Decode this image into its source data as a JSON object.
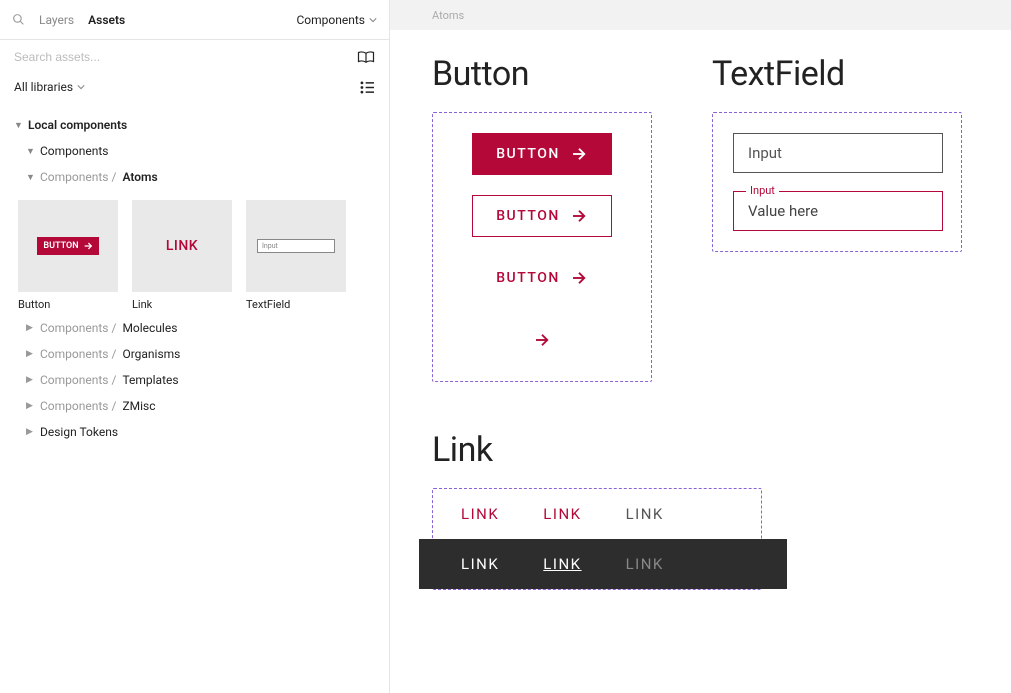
{
  "top": {
    "tab_layers": "Layers",
    "tab_assets": "Assets",
    "pages_dropdown": "Components"
  },
  "search": {
    "placeholder": "Search assets..."
  },
  "lib_filter": "All libraries",
  "tree": {
    "local_components": "Local components",
    "components": "Components",
    "prefix": "Components / ",
    "atoms": "Atoms",
    "molecules": "Molecules",
    "organisms": "Organisms",
    "templates": "Templates",
    "zmisc": "ZMisc",
    "design_tokens": "Design Tokens"
  },
  "thumbs": {
    "button": "Button",
    "link": "Link",
    "textfield": "TextField",
    "mini_btn": "BUTTON",
    "mini_link": "LINK",
    "mini_input": "Input"
  },
  "canvas": {
    "breadcrumb": "Atoms",
    "section_button": "Button",
    "section_textfield": "TextField",
    "section_link": "Link",
    "btn_label": "BUTTON",
    "tf_placeholder": "Input",
    "tf_float_label": "Input",
    "tf_value": "Value here",
    "link_label": "LINK"
  }
}
